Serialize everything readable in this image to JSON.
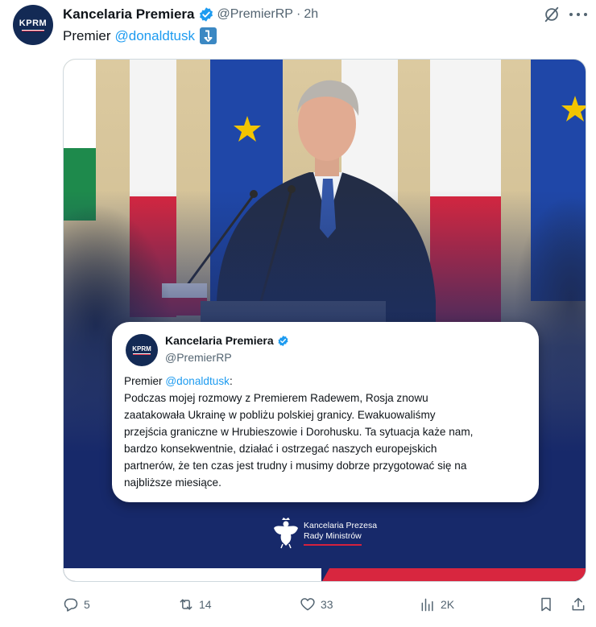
{
  "author": {
    "avatar_text": "KPRM",
    "display_name": "Kancelaria Premiera",
    "handle": "@PremierRP",
    "separator": "·",
    "time": "2h"
  },
  "tweet": {
    "text_prefix": "Premier",
    "mention": "@donaldtusk",
    "emoji": "down-arrow-emoji"
  },
  "media": {
    "quote": {
      "avatar_text": "KPRM",
      "display_name": "Kancelaria Premiera",
      "handle": "@PremierRP",
      "mention": "@donaldtusk",
      "line1_prefix": "Premier ",
      "line1_suffix": ":",
      "lines": [
        "Podczas mojej rozmowy z Premierem Radewem, Rosja znowu",
        "zaatakowała Ukrainę w pobliżu polskiej granicy. Ewakuowaliśmy",
        "przejścia graniczne w Hrubieszowie i Dorohusku. Ta sytuacja każe nam,",
        "bardzo konsekwentnie, działać i ostrzegać naszych europejskich",
        "partnerów, że ten czas jest trudny i musimy dobrze przygotować się na",
        "najbliższe miesiące."
      ]
    },
    "footer": {
      "line1": "Kancelaria Prezesa",
      "line2": "Rady Ministrów"
    }
  },
  "actions": {
    "replies": "5",
    "reposts": "14",
    "likes": "33",
    "views": "2K"
  },
  "colors": {
    "accent": "#1d9bf0",
    "navy": "#132a55",
    "red": "#d4213d",
    "muted": "#536471"
  }
}
